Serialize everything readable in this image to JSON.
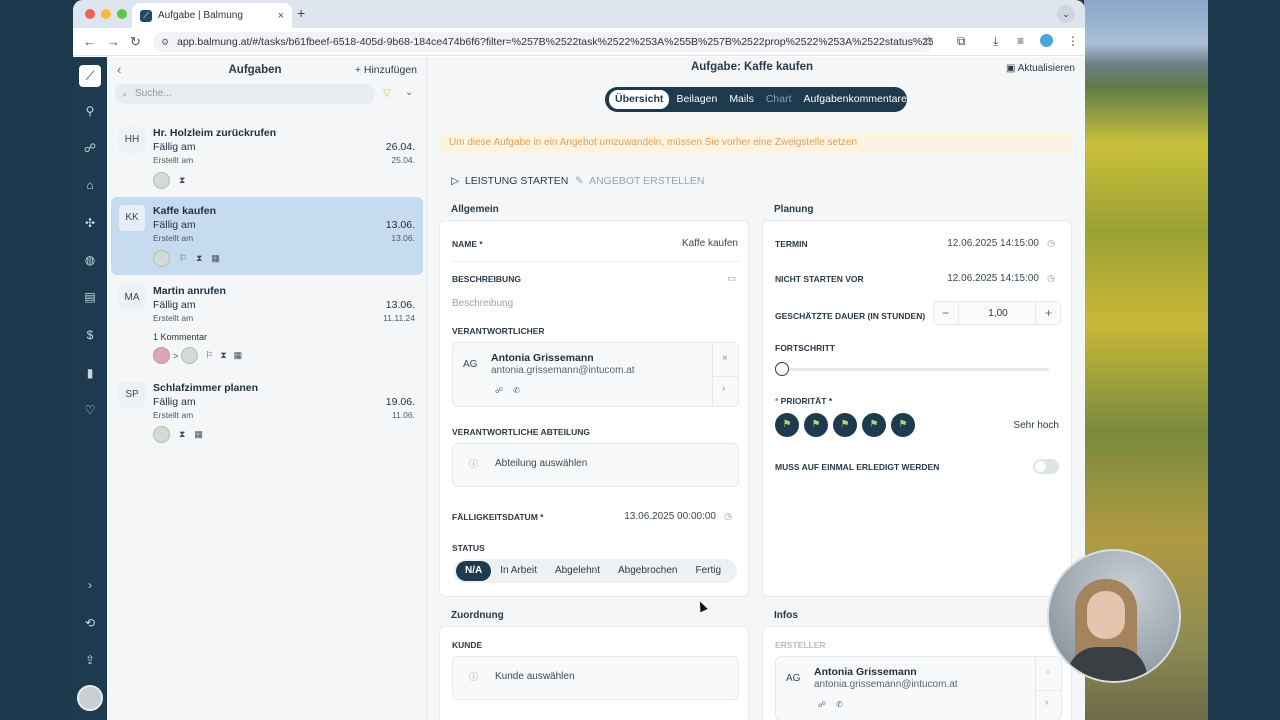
{
  "browser": {
    "tab_title": "Aufgabe | Balmung",
    "url": "app.balmung.at/#/tasks/b61fbeef-6518-405d-9b68-184ce474b6f6?filter=%257B%2522task%2522%253A%255B%257B%2522prop%2522%253A%2522status%25..."
  },
  "tasklist": {
    "title": "Aufgaben",
    "add_label": "Hinzufügen",
    "search_placeholder": "Suche...",
    "tasks": [
      {
        "initials": "HH",
        "name": "Hr. Holzleim zurückrufen",
        "due_label": "Fällig am",
        "due_date": "26.04.",
        "created_label": "Erstellt am",
        "created_date": "25.04."
      },
      {
        "initials": "KK",
        "name": "Kaffe kaufen",
        "due_label": "Fällig am",
        "due_date": "13.06.",
        "created_label": "Erstellt am",
        "created_date": "13.06."
      },
      {
        "initials": "MA",
        "name": "Martin anrufen",
        "due_label": "Fällig am",
        "due_date": "13.06.",
        "created_label": "Erstellt am",
        "created_date": "11.11.24",
        "comment": "1 Kommentar"
      },
      {
        "initials": "SP",
        "name": "Schlafzimmer planen",
        "due_label": "Fällig am",
        "due_date": "19.06.",
        "created_label": "Erstellt am",
        "created_date": "11.06."
      }
    ]
  },
  "main": {
    "title": "Aufgabe: Kaffe kaufen",
    "refresh_label": "Aktualisieren",
    "tabs": [
      "Übersicht",
      "Beilagen",
      "Mails",
      "Chart",
      "Aufgabenkommentare"
    ],
    "warning": "Um diese Aufgabe in ein Angebot umzuwandeln, müssen Sie vorher eine Zweigstelle setzen",
    "action_start": "LEISTUNG STARTEN",
    "action_offer": "ANGEBOT ERSTELLEN",
    "allgemein": {
      "section": "Allgemein",
      "name_label": "NAME *",
      "name_value": "Kaffe kaufen",
      "desc_label": "BESCHREIBUNG",
      "desc_placeholder": "Beschreibung",
      "resp_label": "VERANTWORTLICHER",
      "resp_initials": "AG",
      "resp_name": "Antonia Grissemann",
      "resp_email": "antonia.grissemann@intucom.at",
      "dept_label": "VERANTWORTLICHE ABTEILUNG",
      "dept_placeholder": "Abteilung auswählen",
      "due_label": "FÄLLIGKEITSDATUM *",
      "due_value": "13.06.2025 00:00:00",
      "status_label": "STATUS",
      "status_options": [
        "N/A",
        "In Arbeit",
        "Abgelehnt",
        "Abgebrochen",
        "Fertig"
      ]
    },
    "planung": {
      "section": "Planung",
      "termin_label": "TERMIN",
      "termin_value": "12.06.2025 14:15:00",
      "notbefore_label": "NICHT STARTEN VOR",
      "notbefore_value": "12.06.2025 14:15:00",
      "duration_label": "GESCHÄTZTE DAUER (IN STUNDEN)",
      "duration_value": "1,00",
      "progress_label": "FORTSCHRITT",
      "progress_value": 0,
      "priority_label": "PRIORITÄT *",
      "priority_value": "Sehr hoch",
      "once_label": "MUSS AUF EINMAL ERLEDIGT WERDEN"
    },
    "zuordnung": {
      "section": "Zuordnung",
      "customer_label": "KUNDE",
      "customer_placeholder": "Kunde auswählen"
    },
    "infos": {
      "section": "Infos",
      "creator_label": "ERSTELLER",
      "creator_initials": "AG",
      "creator_name": "Antonia Grissemann",
      "creator_email": "antonia.grissemann@intucom.at"
    }
  },
  "colors": {
    "rail": "#1d3a4e",
    "selected_task": "#c7dbf0",
    "warning_text": "#e4a24a",
    "priority_flag": "#b9d66b"
  }
}
